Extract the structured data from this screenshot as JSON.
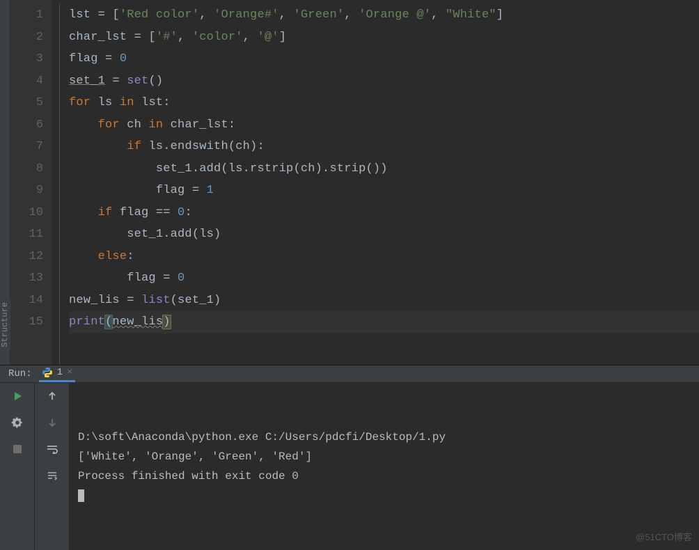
{
  "editor": {
    "gutter": [
      "1",
      "2",
      "3",
      "4",
      "5",
      "6",
      "7",
      "8",
      "9",
      "10",
      "11",
      "12",
      "13",
      "14",
      "15"
    ],
    "current_line_index": 14,
    "lines": [
      [
        [
          "d",
          "lst = ["
        ],
        [
          "s",
          "'Red color'"
        ],
        [
          "d",
          ", "
        ],
        [
          "s",
          "'Orange#'"
        ],
        [
          "d",
          ", "
        ],
        [
          "s",
          "'Green'"
        ],
        [
          "d",
          ", "
        ],
        [
          "s",
          "'Orange @'"
        ],
        [
          "d",
          ", "
        ],
        [
          "s",
          "\"White\""
        ],
        [
          "d",
          "]"
        ]
      ],
      [
        [
          "d",
          "char_lst = ["
        ],
        [
          "s",
          "'#'"
        ],
        [
          "d",
          ", "
        ],
        [
          "s",
          "'color'"
        ],
        [
          "d",
          ", "
        ],
        [
          "s",
          "'@'"
        ],
        [
          "d",
          "]"
        ]
      ],
      [
        [
          "d",
          "flag = "
        ],
        [
          "n",
          "0"
        ]
      ],
      [
        [
          "u",
          "set_1"
        ],
        [
          "d",
          " = "
        ],
        [
          "b",
          "set"
        ],
        [
          "d",
          "()"
        ]
      ],
      [
        [
          "k",
          "for "
        ],
        [
          "d",
          "ls "
        ],
        [
          "k",
          "in "
        ],
        [
          "d",
          "lst:"
        ]
      ],
      [
        [
          "d",
          "    "
        ],
        [
          "k",
          "for "
        ],
        [
          "d",
          "ch "
        ],
        [
          "k",
          "in "
        ],
        [
          "d",
          "char_lst:"
        ]
      ],
      [
        [
          "d",
          "        "
        ],
        [
          "k",
          "if "
        ],
        [
          "d",
          "ls.endswith(ch):"
        ]
      ],
      [
        [
          "d",
          "            set_1.add(ls.rstrip(ch).strip())"
        ]
      ],
      [
        [
          "d",
          "            flag = "
        ],
        [
          "n",
          "1"
        ]
      ],
      [
        [
          "d",
          "    "
        ],
        [
          "k",
          "if "
        ],
        [
          "d",
          "flag == "
        ],
        [
          "n",
          "0"
        ],
        [
          "d",
          ":"
        ]
      ],
      [
        [
          "d",
          "        set_1.add(ls)"
        ]
      ],
      [
        [
          "d",
          "    "
        ],
        [
          "k",
          "else"
        ],
        [
          "d",
          ":"
        ]
      ],
      [
        [
          "d",
          "        flag = "
        ],
        [
          "n",
          "0"
        ]
      ],
      [
        [
          "d",
          "new_lis = "
        ],
        [
          "b",
          "list"
        ],
        [
          "d",
          "(set_1)"
        ]
      ],
      [
        [
          "b",
          "print"
        ],
        [
          "hl-paren d",
          "("
        ],
        [
          "d warn",
          "new_lis"
        ],
        [
          "caret-paren d",
          ")"
        ]
      ]
    ]
  },
  "sidebar": {
    "structure_label": "Structure"
  },
  "run": {
    "label": "Run:",
    "tab_name": "1",
    "output": [
      "D:\\soft\\Anaconda\\python.exe C:/Users/pdcfi/Desktop/1.py",
      "['White', 'Orange', 'Green', 'Red']",
      "",
      "Process finished with exit code 0"
    ]
  },
  "watermark": "@51CTO博客"
}
